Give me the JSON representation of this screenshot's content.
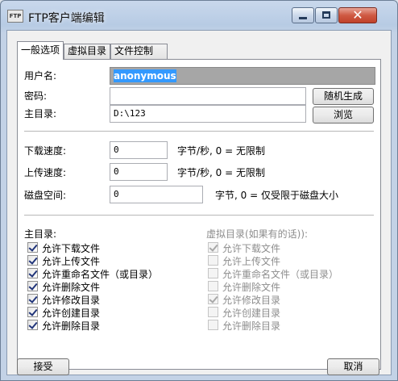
{
  "window": {
    "title": "FTP客户端编辑",
    "icon": "ftp-app-icon",
    "close_glyph": "✕"
  },
  "tabs": [
    {
      "label": "一般选项",
      "active": true
    },
    {
      "label": "虚拟目录",
      "active": false
    },
    {
      "label": "文件控制",
      "active": false
    }
  ],
  "general": {
    "username_label": "用户名:",
    "username_value": "anonymous",
    "password_label": "密码:",
    "password_value": "",
    "home_label": "主目录:",
    "home_value": "D:\\123",
    "random_button": "随机生成",
    "browse_button": "浏览"
  },
  "limits": {
    "download_label": "下载速度:",
    "download_value": "0",
    "download_unit": "字节/秒, 0 = 无限制",
    "upload_label": "上传速度:",
    "upload_value": "0",
    "upload_unit": "字节/秒, 0 = 无限制",
    "disk_label": "磁盘空间:",
    "disk_value": "0",
    "disk_unit": "字节, 0 = 仅受限于磁盘大小"
  },
  "permissions": {
    "home_heading": "主目录:",
    "virtual_heading": "虚拟目录(如果有的话)):",
    "home_items": [
      {
        "label": "允许下载文件",
        "checked": true
      },
      {
        "label": "允许上传文件",
        "checked": true
      },
      {
        "label": "允许重命名文件（或目录）",
        "checked": true
      },
      {
        "label": "允许删除文件",
        "checked": true
      },
      {
        "label": "允许修改目录",
        "checked": true
      },
      {
        "label": "允许创建目录",
        "checked": true
      },
      {
        "label": "允许删除目录",
        "checked": true
      }
    ],
    "virtual_items": [
      {
        "label": "允许下载文件",
        "checked": true
      },
      {
        "label": "允许上传文件",
        "checked": false
      },
      {
        "label": "允许重命名文件（或目录）",
        "checked": false
      },
      {
        "label": "允许删除文件",
        "checked": false
      },
      {
        "label": "允许修改目录",
        "checked": true
      },
      {
        "label": "允许创建目录",
        "checked": false
      },
      {
        "label": "允许删除目录",
        "checked": false
      }
    ]
  },
  "footer": {
    "accept_button": "接受",
    "cancel_button": "取消"
  }
}
